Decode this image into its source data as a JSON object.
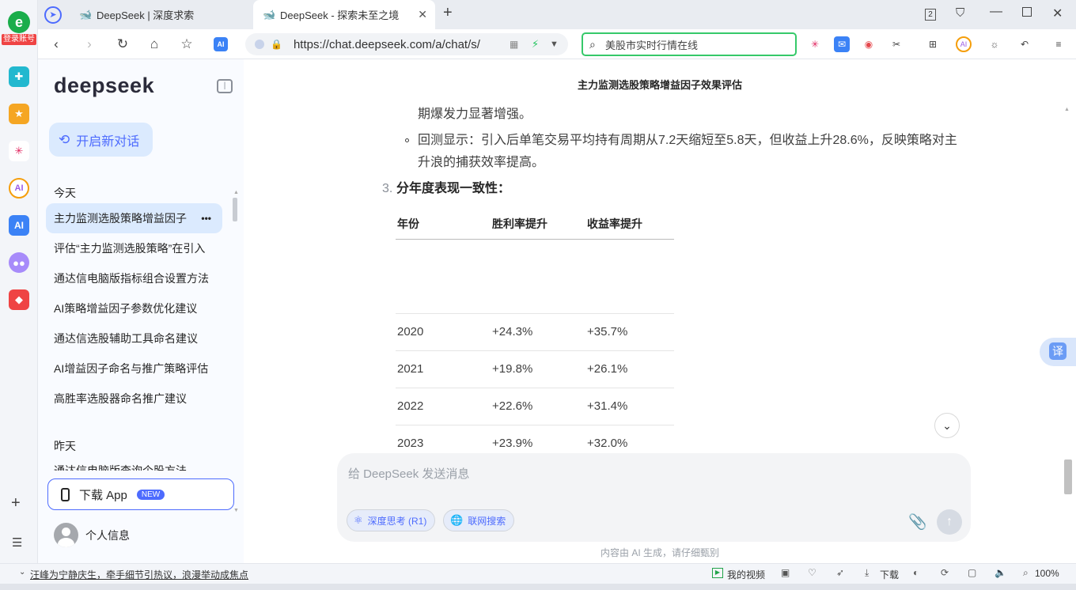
{
  "browser": {
    "login_badge": "登录账号",
    "tabs": [
      {
        "title": "DeepSeek | 深度求索",
        "active": false
      },
      {
        "title": "DeepSeek - 探索未至之境",
        "active": true
      }
    ],
    "tab_count": "2",
    "url": "https://chat.deepseek.com/a/chat/s/",
    "search_placeholder": "美股市实时行情在线"
  },
  "sidebar": {
    "logo": "deepseek",
    "new_chat_label": "开启新对话",
    "groups": [
      {
        "title": "今天",
        "items": [
          "主力监测选股策略增益因子",
          "评估“主力监测选股策略”在引入",
          "通达信电脑版指标组合设置方法",
          "AI策略增益因子参数优化建议",
          "通达信选股辅助工具命名建议",
          "AI增益因子命名与推广策略评估",
          "高胜率选股器命名推广建议"
        ]
      },
      {
        "title": "昨天",
        "items": [
          "通达信电脑版查询个股方法"
        ]
      }
    ],
    "more_icon": "•••",
    "download_app_label": "下载 App",
    "new_badge": "NEW",
    "profile_label": "个人信息"
  },
  "main": {
    "chat_title": "主力监测选股策略增益因子效果评估",
    "lines": {
      "line1": "期爆发力显著增强。",
      "line2a": "回测显示：引入后单笔交易平均持有周期从7.2天缩短至5.8天，但收益上升28.6%，反映策略对主",
      "line2b": "升浪的捕获效率提高。",
      "heading_num": "3.",
      "heading": "分年度表现一致性："
    },
    "table": {
      "headers": [
        "年份",
        "胜利率提升",
        "收益率提升"
      ],
      "rows": [
        [
          "2020",
          "+24.3%",
          "+35.7%"
        ],
        [
          "2021",
          "+19.8%",
          "+26.1%"
        ],
        [
          "2022",
          "+22.6%",
          "+31.4%"
        ],
        [
          "2023",
          "+23.9%",
          "+32.0%"
        ]
      ]
    },
    "composer_placeholder": "给 DeepSeek 发送消息",
    "deep_think_label": "深度思考 (R1)",
    "web_search_label": "联网搜索",
    "disclaimer": "内容由 AI 生成，请仔细甄别",
    "translate_label": "译"
  },
  "statusbar": {
    "news": "汪峰为宁静庆生，牵手细节引热议，浪漫举动成焦点",
    "my_video": "我的视频",
    "download": "下载",
    "zoom": "100%"
  },
  "colors": {
    "accent": "#4d6bfe",
    "sidebar_bg": "#f9fbff",
    "active_item_bg": "#dbeafe",
    "search_border": "#36c96a"
  }
}
